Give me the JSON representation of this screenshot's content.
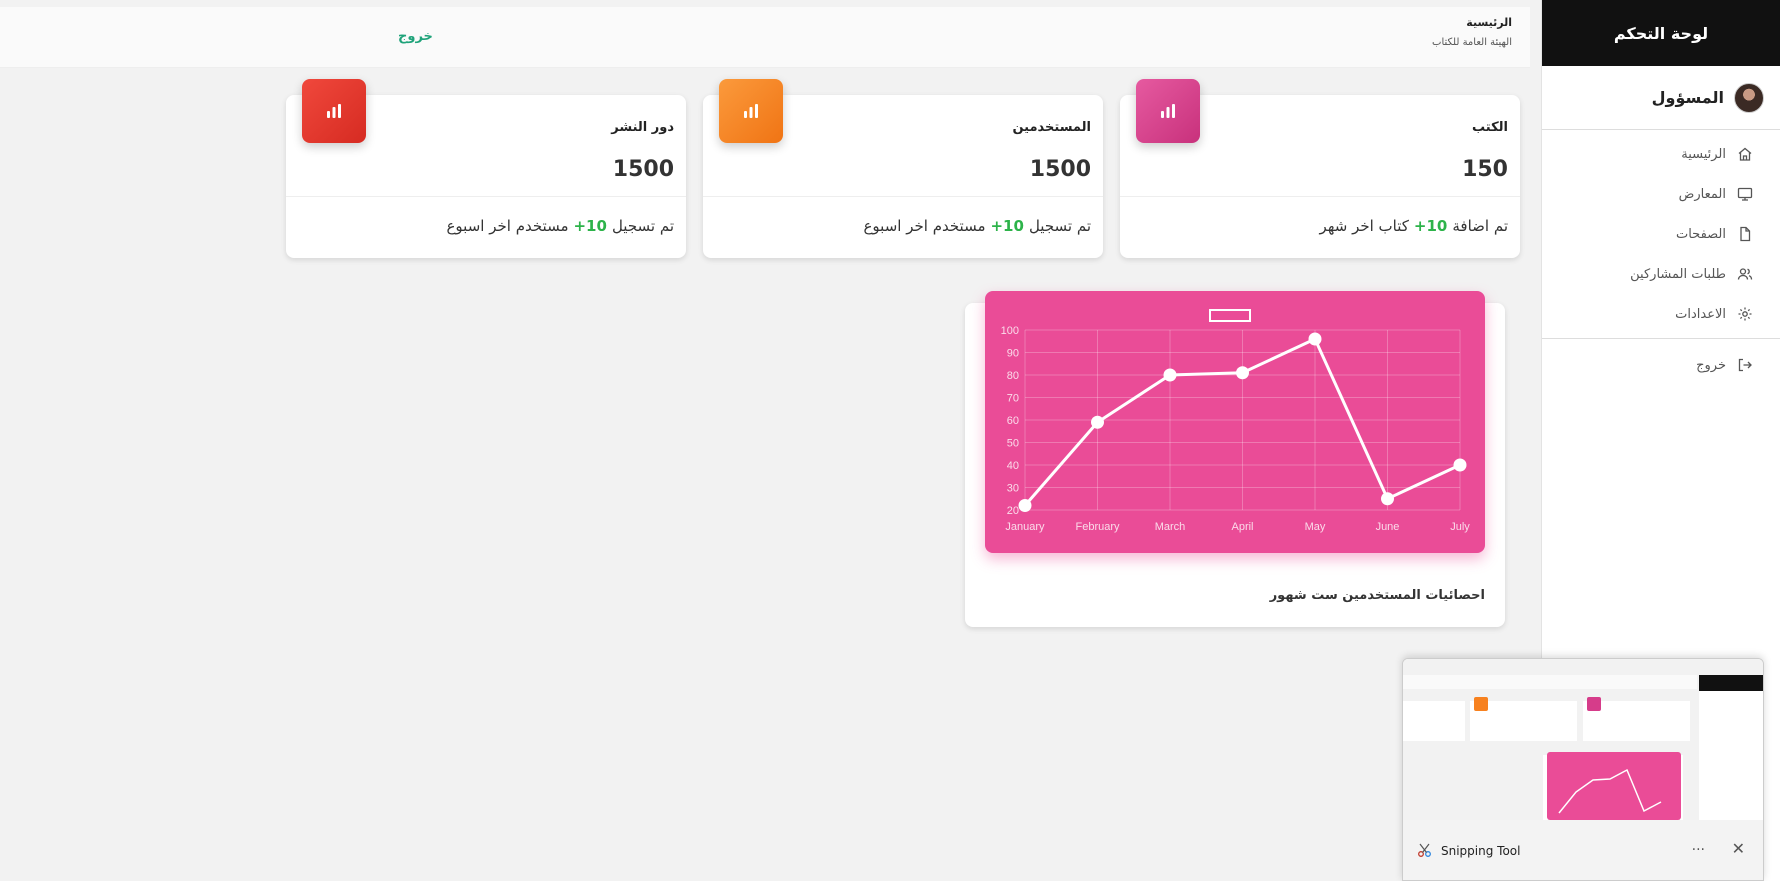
{
  "sidebar": {
    "title": "لوحة التحكم",
    "user": "المسؤول",
    "items": [
      {
        "label": "الرئيسية",
        "icon": "home-icon"
      },
      {
        "label": "المعارض",
        "icon": "monitor-icon"
      },
      {
        "label": "الصفحات",
        "icon": "file-icon"
      },
      {
        "label": "طلبات المشاركين",
        "icon": "users-icon"
      },
      {
        "label": "الاعدادات",
        "icon": "gear-icon"
      }
    ],
    "logout": {
      "label": "خروج",
      "icon": "logout-icon"
    }
  },
  "topbar": {
    "title": "الرئيسية",
    "subtitle": "الهيئة العامة للكتاب",
    "logout": "خروج"
  },
  "cards": [
    {
      "title": "الكتب",
      "value": "150",
      "color": "#d63c8a",
      "foot_prefix": "تم اضافة",
      "foot_highlight": "+10",
      "foot_suffix": "كتاب اخر شهر"
    },
    {
      "title": "المستخدمين",
      "value": "1500",
      "color": "#f7811f",
      "foot_prefix": "تم تسجيل",
      "foot_highlight": "+10",
      "foot_suffix": "مستخدم اخر اسبوع"
    },
    {
      "title": "دور النشر",
      "value": "1500",
      "color": "#e53a2f",
      "foot_prefix": "تم تسجيل",
      "foot_highlight": "+10",
      "foot_suffix": "مستخدم اخر اسبوع"
    }
  ],
  "chart_caption": "احصائيات المستخدمين ست شهور",
  "chart_data": {
    "type": "line",
    "categories": [
      "January",
      "February",
      "March",
      "April",
      "May",
      "June",
      "July"
    ],
    "series": [
      {
        "values": [
          22,
          59,
          80,
          81,
          96,
          25,
          40
        ]
      }
    ],
    "yticks": [
      20,
      30,
      40,
      50,
      60,
      70,
      80,
      90,
      100
    ],
    "ylim": [
      20,
      100
    ],
    "grid": true,
    "legend": "top-center",
    "background": "#ea4c97",
    "line_color": "#ffffff"
  },
  "snipping_tool": {
    "name": "Snipping Tool",
    "more": "···",
    "close": "✕"
  }
}
